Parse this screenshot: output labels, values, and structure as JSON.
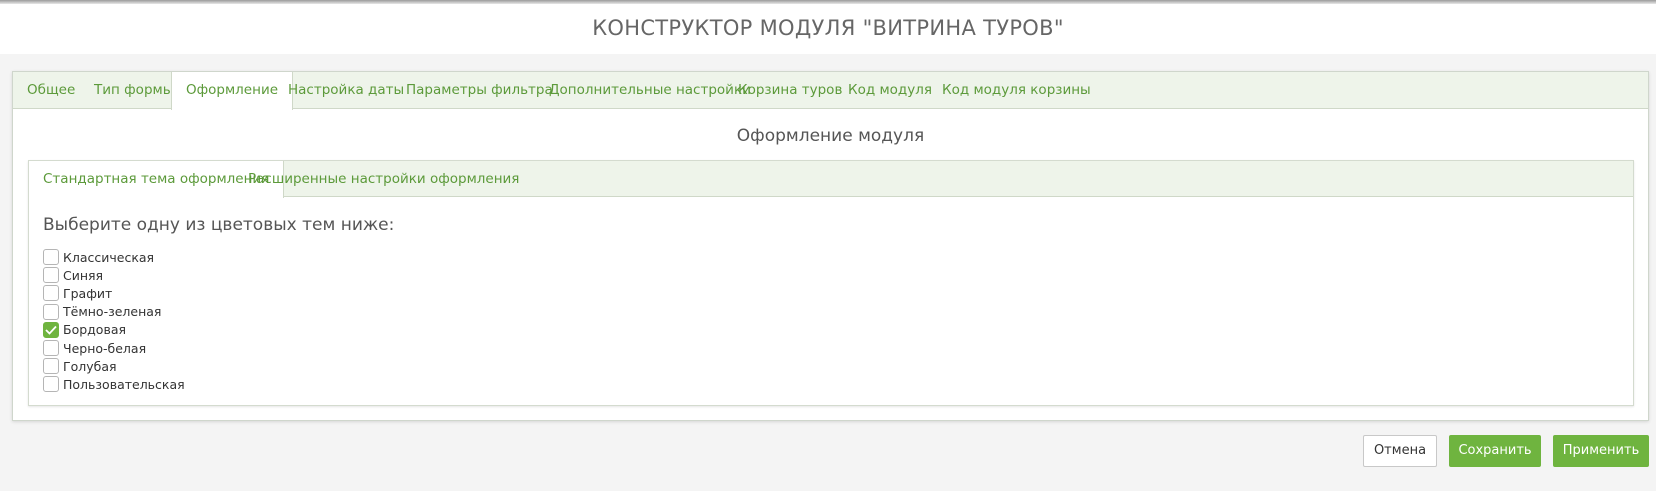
{
  "header": {
    "title": "КОНСТРУКТОР МОДУЛЯ \"ВИТРИНА ТУРОВ\""
  },
  "tabs": [
    {
      "label": "Общее"
    },
    {
      "label": "Тип формы"
    },
    {
      "label": "Оформление",
      "active": true
    },
    {
      "label": "Настройка даты"
    },
    {
      "label": "Параметры фильтра"
    },
    {
      "label": "Дополнительные настройки"
    },
    {
      "label": "Корзина туров"
    },
    {
      "label": "Код модуля"
    },
    {
      "label": "Код модуля корзины"
    }
  ],
  "section": {
    "title": "Оформление модуля"
  },
  "subtabs": [
    {
      "label": "Стандартная тема оформления",
      "active": true
    },
    {
      "label": "Расширенные настройки оформления"
    }
  ],
  "themes": {
    "prompt": "Выберите одну из цветовых тем ниже:",
    "options": [
      {
        "label": "Классическая",
        "checked": false
      },
      {
        "label": "Синяя",
        "checked": false
      },
      {
        "label": "Графит",
        "checked": false
      },
      {
        "label": "Тёмно-зеленая",
        "checked": false
      },
      {
        "label": "Бордовая",
        "checked": true
      },
      {
        "label": "Черно-белая",
        "checked": false
      },
      {
        "label": "Голубая",
        "checked": false
      },
      {
        "label": "Пользовательская",
        "checked": false
      }
    ]
  },
  "actions": {
    "cancel_label": "Отмена",
    "save_label": "Сохранить",
    "apply_label": "Применить"
  },
  "colors": {
    "accent": "#6fb43f",
    "tab_text": "#5c9a3a",
    "tab_bar_bg": "#eef4ea"
  }
}
